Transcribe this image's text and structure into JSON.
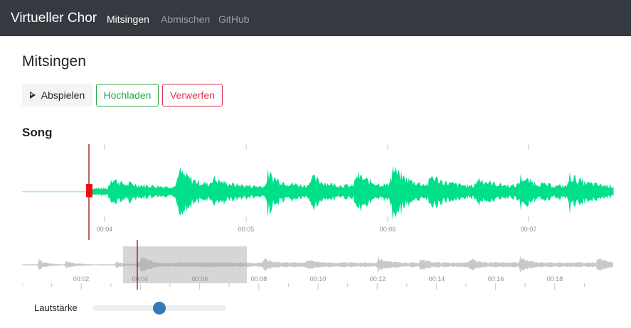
{
  "navbar": {
    "brand": "Virtueller Chor",
    "links": [
      {
        "label": "Mitsingen",
        "active": true
      },
      {
        "label": "Abmischen",
        "active": false
      },
      {
        "label": "GitHub",
        "active": false
      }
    ]
  },
  "page": {
    "title": "Mitsingen"
  },
  "toolbar": {
    "play_icon": "play-icon",
    "play_label": "Abspielen",
    "upload_label": "Hochladen",
    "discard_label": "Verwerfen"
  },
  "song": {
    "title": "Song",
    "main_timeline": {
      "tick_labels": [
        "00:04",
        "00:05",
        "00:06",
        "00:07"
      ]
    },
    "overview_timeline": {
      "tick_labels": [
        "00:02",
        "00:04",
        "00:06",
        "00:08",
        "00:10",
        "00:12",
        "00:14",
        "00:16",
        "00:18"
      ]
    }
  },
  "volume": {
    "label": "Lautstärke",
    "value": 0.5
  },
  "colors": {
    "navbar": "#343a40",
    "wave_main": "#00e08a",
    "wave_main_progress": "#b6ecd5",
    "playhead": "#8b0000",
    "playhead_handle": "#ee1111",
    "wave_overview": "#c9c9c9",
    "overview_region": "#d2d2d2",
    "upload": "#28a745",
    "discard": "#dc3545",
    "slider_thumb": "#337ab7"
  }
}
